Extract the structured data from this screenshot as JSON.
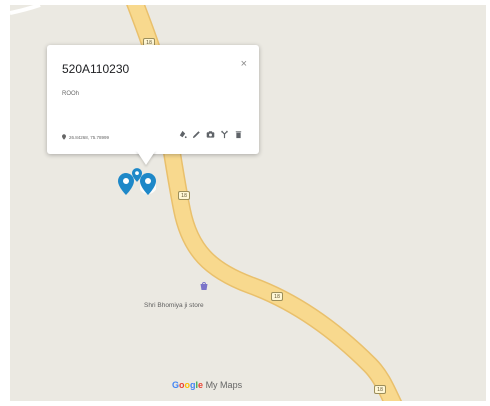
{
  "popup": {
    "title": "520A110230",
    "close_label": "×",
    "description": "ROOh",
    "coordinates": "26.84268, 75.78999",
    "tools": [
      "style-icon",
      "edit-icon",
      "photo-icon",
      "directions-icon",
      "delete-icon"
    ]
  },
  "route_shields": [
    "18",
    "18",
    "18",
    "18"
  ],
  "place": {
    "label": "Shri Bhomiya ji store",
    "icon": "store-icon"
  },
  "branding": {
    "google": "Google",
    "product": "My Maps"
  },
  "colors": {
    "road": "#f8d98e",
    "road_edge": "#e9c06c",
    "land": "#ebe9e2",
    "marker": "#1e88c8",
    "google_blue": "#4285f4",
    "google_red": "#ea4335",
    "google_yellow": "#fbbc05",
    "google_green": "#34a853"
  }
}
